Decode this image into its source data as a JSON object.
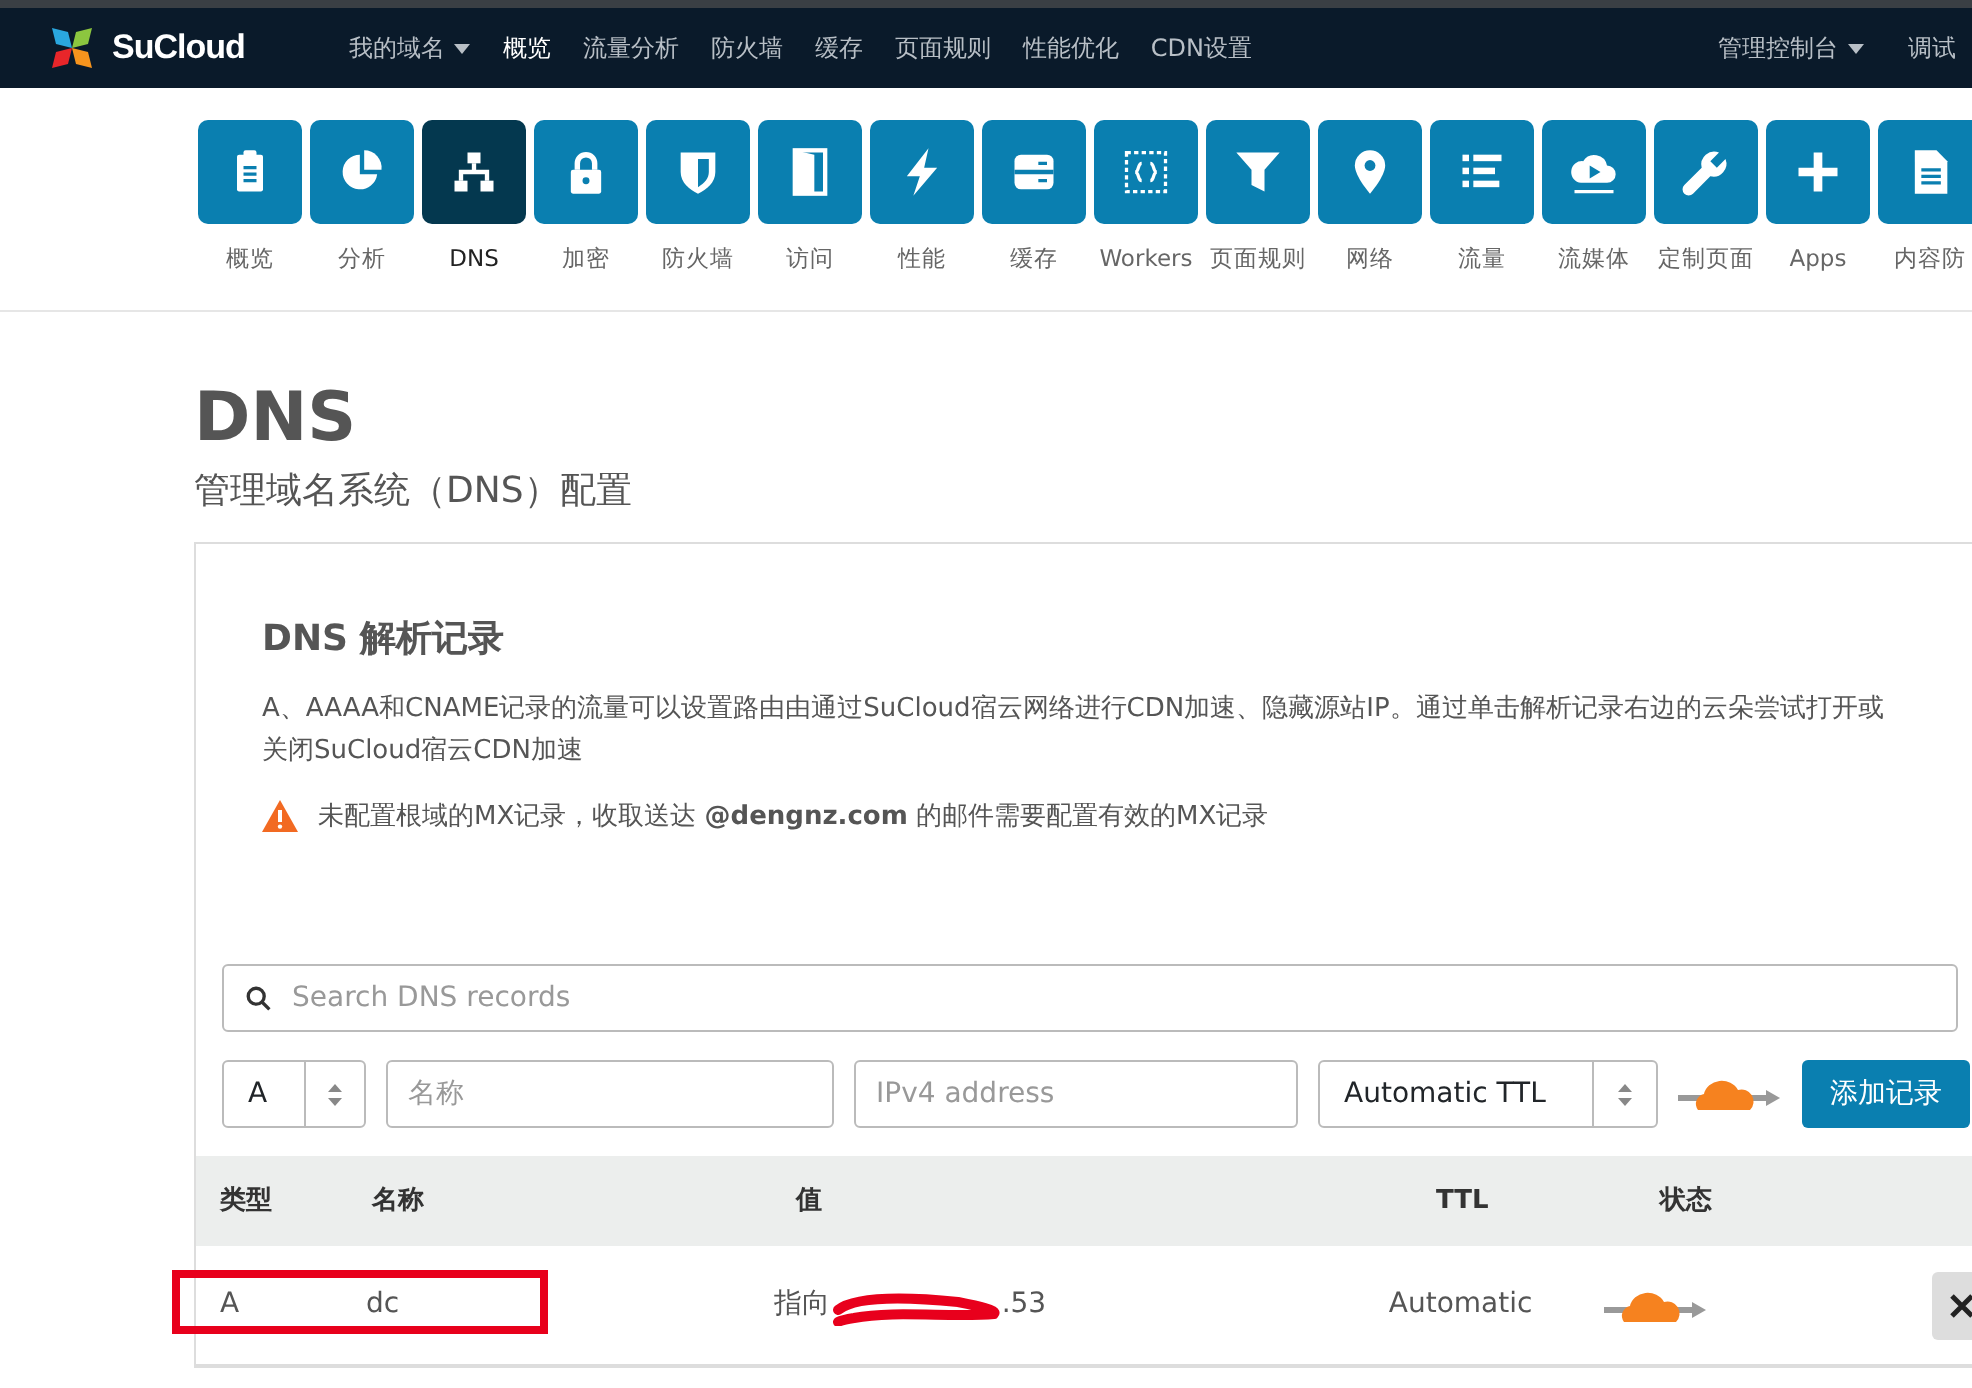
{
  "navbar": {
    "brand": "SuCloud",
    "items": [
      {
        "label": "我的域名",
        "dropdown": true,
        "selected": false
      },
      {
        "label": "概览",
        "dropdown": false,
        "selected": true
      },
      {
        "label": "流量分析",
        "dropdown": false,
        "selected": false
      },
      {
        "label": "防火墙",
        "dropdown": false,
        "selected": false
      },
      {
        "label": "缓存",
        "dropdown": false,
        "selected": false
      },
      {
        "label": "页面规则",
        "dropdown": false,
        "selected": false
      },
      {
        "label": "性能优化",
        "dropdown": false,
        "selected": false
      },
      {
        "label": "CDN设置",
        "dropdown": false,
        "selected": false
      }
    ],
    "right_items": [
      {
        "label": "管理控制台",
        "dropdown": true
      },
      {
        "label": "调试",
        "dropdown": false
      }
    ]
  },
  "app_tiles": [
    {
      "label": "概览",
      "selected": false
    },
    {
      "label": "分析",
      "selected": false
    },
    {
      "label": "DNS",
      "selected": true
    },
    {
      "label": "加密",
      "selected": false
    },
    {
      "label": "防火墙",
      "selected": false
    },
    {
      "label": "访问",
      "selected": false
    },
    {
      "label": "性能",
      "selected": false
    },
    {
      "label": "缓存",
      "selected": false
    },
    {
      "label": "Workers",
      "selected": false
    },
    {
      "label": "页面规则",
      "selected": false
    },
    {
      "label": "网络",
      "selected": false
    },
    {
      "label": "流量",
      "selected": false
    },
    {
      "label": "流媒体",
      "selected": false
    },
    {
      "label": "定制页面",
      "selected": false
    },
    {
      "label": "Apps",
      "selected": false
    },
    {
      "label": "内容防",
      "selected": false
    }
  ],
  "page": {
    "title": "DNS",
    "subtitle": "管理域名系统（DNS）配置"
  },
  "card": {
    "title": "DNS 解析记录",
    "description": "A、AAAA和CNAME记录的流量可以设置路由由通过SuCloud宿云网络进行CDN加速、隐藏源站IP。通过单击解析记录右边的云朵尝试打开或关闭SuCloud宿云CDN加速",
    "warning": "未配置根域的MX记录，收取送达 **@dengnz.com** 的邮件需要配置有效的MX记录"
  },
  "search": {
    "placeholder": "Search DNS records"
  },
  "add_form": {
    "type": "A",
    "name_placeholder": "名称",
    "value_placeholder": "IPv4 address",
    "ttl": "Automatic TTL",
    "proxied": true,
    "button": "添加记录"
  },
  "table": {
    "columns": [
      "类型",
      "名称",
      "值",
      "TTL",
      "状态"
    ],
    "rows": [
      {
        "type": "A",
        "name": "dc",
        "value_prefix": "指向",
        "value_suffix": ".53",
        "value_redacted": true,
        "ttl": "Automatic",
        "proxied": true,
        "highlighted": true
      }
    ]
  }
}
